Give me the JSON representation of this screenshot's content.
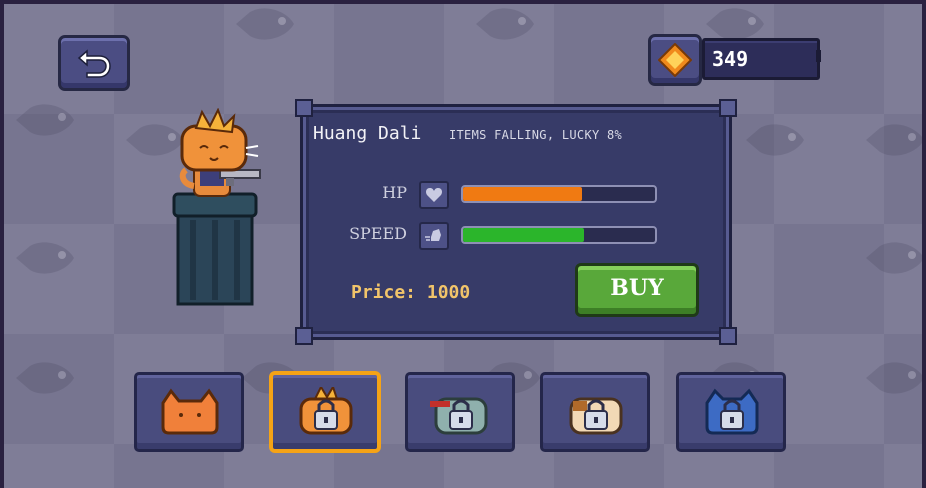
{
  "coins": {
    "value": "349"
  },
  "hero": {
    "name": "Huang Dali",
    "description": "ITEMS FALLING, LUCKY 8%",
    "stats": [
      {
        "label": "HP",
        "icon": "heart-icon",
        "fraction": 0.62,
        "color": "#f07a12"
      },
      {
        "label": "SPEED",
        "icon": "speed-boot-icon",
        "fraction": 0.63,
        "color": "#2bb52b"
      }
    ],
    "price_label": "Price: 1000"
  },
  "buttons": {
    "buy_label": "BUY"
  },
  "characters": [
    {
      "name": "orange-cat",
      "locked": false,
      "selected": false,
      "color": "#f0803a"
    },
    {
      "name": "orange-spiky-cat",
      "locked": true,
      "selected": true,
      "color": "#f0923a"
    },
    {
      "name": "grey-ninja-cat",
      "locked": true,
      "selected": false,
      "color": "#8fb0ad"
    },
    {
      "name": "calico-cat",
      "locked": true,
      "selected": false,
      "color": "#f2d9b6"
    },
    {
      "name": "blue-cat",
      "locked": true,
      "selected": false,
      "color": "#3d6bc4"
    }
  ],
  "colors": {
    "accent_gold": "#f1c46a",
    "buy_green": "#59a83a",
    "select_orange": "#f5a316"
  }
}
